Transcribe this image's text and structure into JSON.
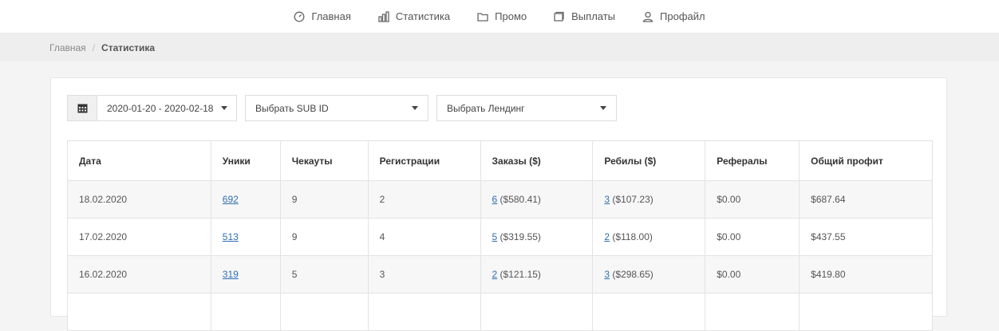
{
  "nav": {
    "items": [
      {
        "label": "Главная",
        "icon": "gauge-icon"
      },
      {
        "label": "Статистика",
        "icon": "bar-chart-icon"
      },
      {
        "label": "Промо",
        "icon": "folder-icon"
      },
      {
        "label": "Выплаты",
        "icon": "wallet-icon"
      },
      {
        "label": "Профайл",
        "icon": "user-icon"
      }
    ]
  },
  "breadcrumb": {
    "home": "Главная",
    "separator": "/",
    "current": "Статистика"
  },
  "filters": {
    "date_range": "2020-01-20 - 2020-02-18",
    "sub_id": "Выбрать SUB ID",
    "landing": "Выбрать Лендинг"
  },
  "table": {
    "headers": [
      "Дата",
      "Уники",
      "Чекауты",
      "Регистрации",
      "Заказы ($)",
      "Ребилы ($)",
      "Рефералы",
      "Общий профит"
    ],
    "rows": [
      {
        "date": "18.02.2020",
        "uniques": "692",
        "checkouts": "9",
        "registrations": "2",
        "orders_count": "6",
        "orders_amount": " ($580.41)",
        "rebills_count": "3",
        "rebills_amount": " ($107.23)",
        "referrals": "$0.00",
        "profit": "$687.64"
      },
      {
        "date": "17.02.2020",
        "uniques": "513",
        "checkouts": "9",
        "registrations": "4",
        "orders_count": "5",
        "orders_amount": " ($319.55)",
        "rebills_count": "2",
        "rebills_amount": " ($118.00)",
        "referrals": "$0.00",
        "profit": "$437.55"
      },
      {
        "date": "16.02.2020",
        "uniques": "319",
        "checkouts": "5",
        "registrations": "3",
        "orders_count": "2",
        "orders_amount": " ($121.15)",
        "rebills_count": "3",
        "rebills_amount": " ($298.65)",
        "referrals": "$0.00",
        "profit": "$419.80"
      }
    ]
  },
  "colors": {
    "link": "#2f6fb3",
    "background": "#f4f4f4",
    "breadcrumb_bar": "#eeeeee"
  }
}
